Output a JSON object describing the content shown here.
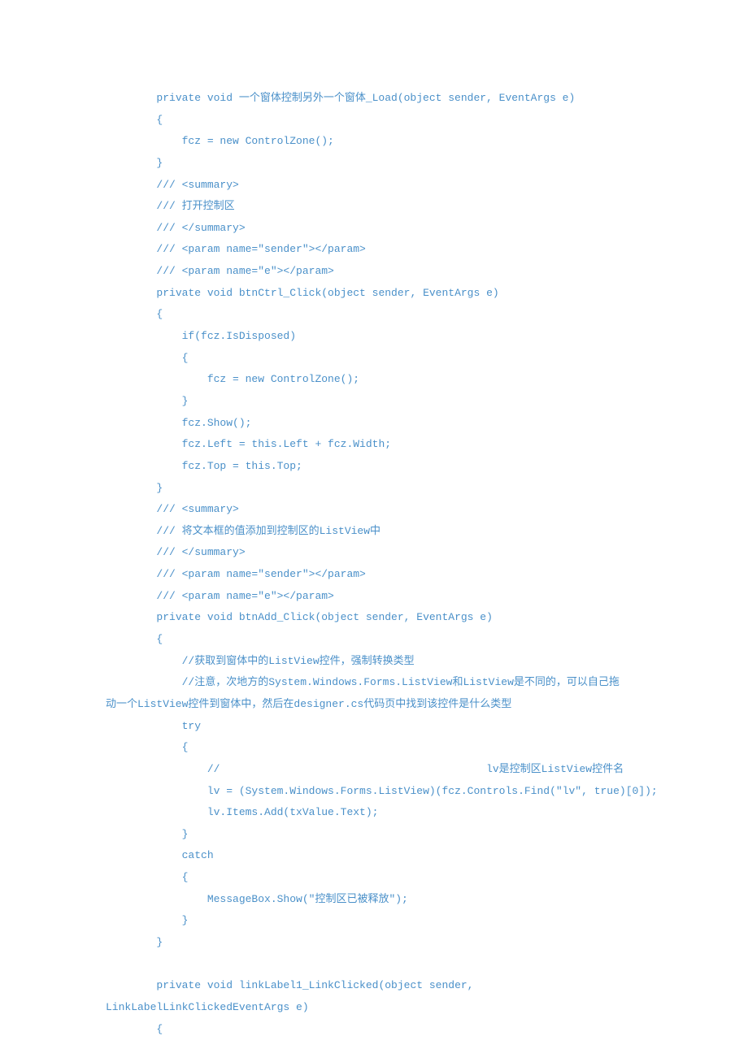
{
  "lines": [
    "        private void 一个窗体控制另外一个窗体_Load(object sender, EventArgs e)",
    "        {",
    "            fcz = new ControlZone();",
    "        }",
    "        /// <summary>",
    "        /// 打开控制区",
    "        /// </summary>",
    "        /// <param name=\"sender\"></param>",
    "        /// <param name=\"e\"></param>",
    "        private void btnCtrl_Click(object sender, EventArgs e)",
    "        {",
    "            if(fcz.IsDisposed)",
    "            {",
    "                fcz = new ControlZone();",
    "            }",
    "            fcz.Show();",
    "            fcz.Left = this.Left + fcz.Width;",
    "            fcz.Top = this.Top;",
    "        }",
    "        /// <summary>",
    "        /// 将文本框的值添加到控制区的ListView中",
    "        /// </summary>",
    "        /// <param name=\"sender\"></param>",
    "        /// <param name=\"e\"></param>",
    "        private void btnAdd_Click(object sender, EventArgs e)",
    "        {",
    "            //获取到窗体中的ListView控件，强制转换类型",
    "            //注意，次地方的System.Windows.Forms.ListView和ListView是不同的，可以自己拖",
    "动一个ListView控件到窗体中，然后在designer.cs代码页中找到该控件是什么类型",
    "            try",
    "            {",
    "                //                                          lv是控制区ListView控件名",
    "                lv = (System.Windows.Forms.ListView)(fcz.Controls.Find(\"lv\", true)[0]);",
    "                lv.Items.Add(txValue.Text);",
    "            }",
    "            catch",
    "            {",
    "                MessageBox.Show(\"控制区已被释放\");",
    "            }",
    "        }",
    "",
    "        private void linkLabel1_LinkClicked(object sender, ",
    "LinkLabelLinkClickedEventArgs e)",
    "        {"
  ]
}
